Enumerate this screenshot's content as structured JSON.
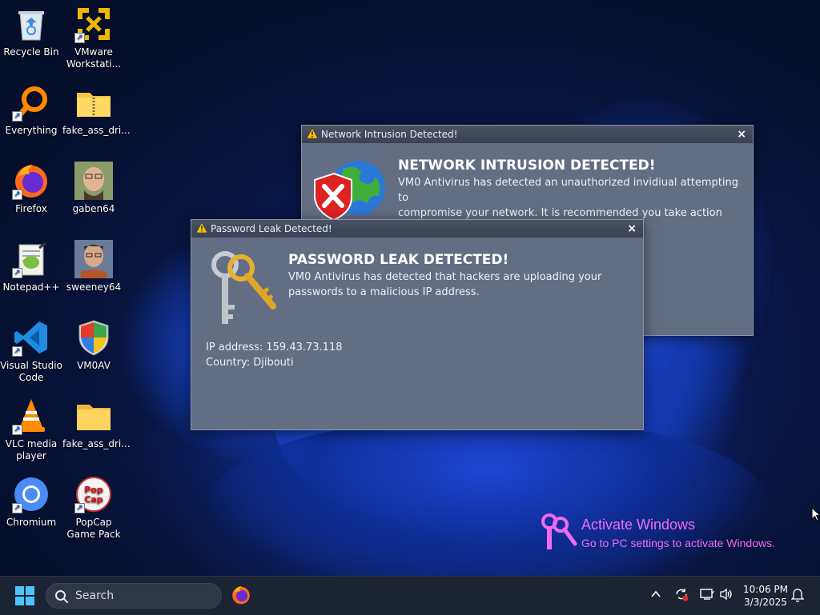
{
  "desktop": {
    "icons": [
      {
        "label": "Recycle Bin",
        "icon": "recycle-bin-icon"
      },
      {
        "label": "VMware Workstati...",
        "icon": "vmware-icon"
      },
      {
        "label": "Everything",
        "icon": "everything-search-icon"
      },
      {
        "label": "fake_ass_dri...",
        "icon": "folder-icon"
      },
      {
        "label": "Firefox",
        "icon": "firefox-icon"
      },
      {
        "label": "gaben64",
        "icon": "photo-icon"
      },
      {
        "label": "Notepad++",
        "icon": "notepad-plus-plus-icon"
      },
      {
        "label": "sweeney64",
        "icon": "photo-icon"
      },
      {
        "label": "Visual Studio Code",
        "icon": "vscode-icon"
      },
      {
        "label": "VM0AV",
        "icon": "shield-icon"
      },
      {
        "label": "VLC media player",
        "icon": "vlc-icon"
      },
      {
        "label": "fake_ass_dri...",
        "icon": "folder-icon"
      },
      {
        "label": "Chromium",
        "icon": "chromium-icon"
      },
      {
        "label": "PopCap Game Pack",
        "icon": "popcap-icon"
      }
    ]
  },
  "network_dialog": {
    "title": "Network Intrusion Detected!",
    "headline": "NETWORK INTRUSION DETECTED!",
    "message_line1": "VM0 Antivirus has detected an unauthorized invidiual attempting to",
    "message_line2": "compromise your network. It is recommended you take action now.",
    "close": "×"
  },
  "password_dialog": {
    "title": "Password Leak Detected!",
    "headline": "PASSWORD LEAK DETECTED!",
    "message_line1": "VM0 Antivirus has detected that hackers are uploading your",
    "message_line2": "passwords to a malicious IP address.",
    "ip_line": "IP address: 159.43.73.118",
    "country_line": "Country: Djibouti",
    "close": "×"
  },
  "activate_windows": {
    "title": "Activate Windows",
    "subtitle": "Go to PC settings to activate Windows."
  },
  "taskbar": {
    "search_label": "Search",
    "time": "10:06 PM",
    "date": "3/3/2025"
  },
  "colors": {
    "dialog_bg": "#636d84",
    "activate_text": "#f06bf0",
    "taskbar_bg": "#1c2333"
  }
}
